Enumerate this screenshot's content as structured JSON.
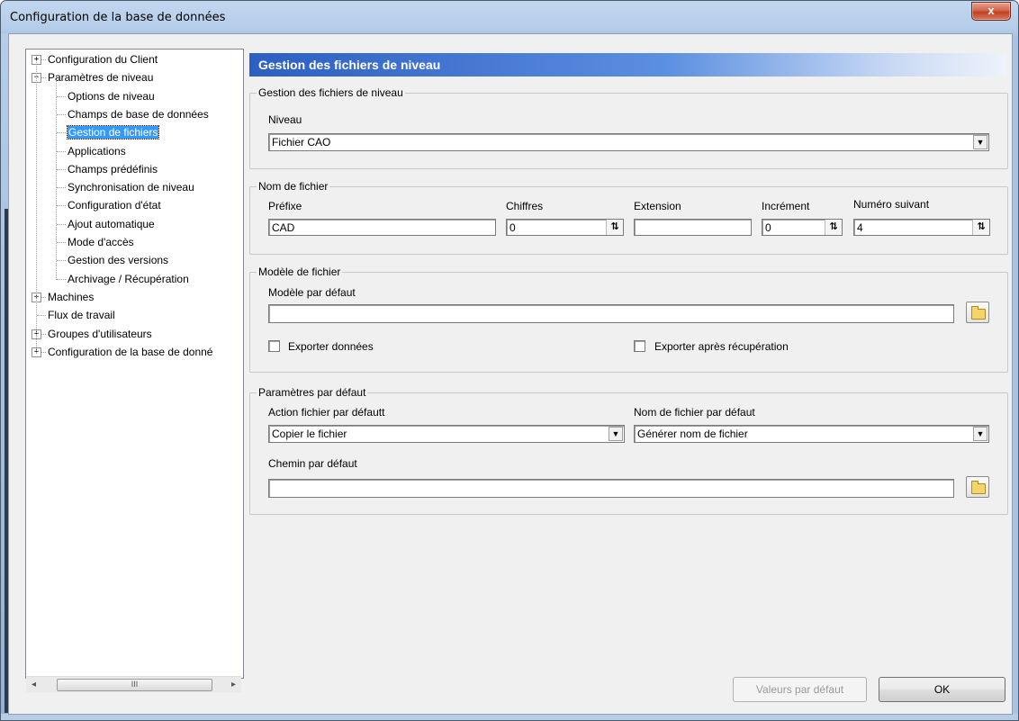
{
  "window": {
    "title": "Configuration de la base de données",
    "close_glyph": "x"
  },
  "tree": {
    "items": [
      {
        "label": "Configuration du Client",
        "expander": "+"
      },
      {
        "label": "Paramètres de niveau",
        "expander": "−"
      },
      {
        "label": "Options de niveau"
      },
      {
        "label": "Champs de base de données"
      },
      {
        "label": "Gestion de fichiers",
        "selected": true
      },
      {
        "label": "Applications"
      },
      {
        "label": "Champs prédéfinis"
      },
      {
        "label": "Synchronisation de niveau"
      },
      {
        "label": "Configuration d'état"
      },
      {
        "label": "Ajout automatique"
      },
      {
        "label": "Mode d'accès"
      },
      {
        "label": "Gestion des versions"
      },
      {
        "label": "Archivage / Récupération"
      },
      {
        "label": "Machines",
        "expander": "+"
      },
      {
        "label": "Flux de travail"
      },
      {
        "label": "Groupes d'utilisateurs",
        "expander": "+"
      },
      {
        "label": "Configuration de la base de donné",
        "expander": "+"
      }
    ],
    "scroll_thumb_glyph": "III"
  },
  "panel": {
    "header": "Gestion des fichiers de niveau",
    "group_level": {
      "title": "Gestion des fichiers de niveau",
      "niveau_label": "Niveau",
      "niveau_value": "Fichier CAO"
    },
    "group_filename": {
      "title": "Nom de fichier",
      "prefix_label": "Préfixe",
      "prefix_value": "CAD",
      "digits_label": "Chiffres",
      "digits_value": "0",
      "extension_label": "Extension",
      "extension_value": "",
      "increment_label": "Incrément",
      "increment_value": "0",
      "next_label": "Numéro suivant",
      "next_value": "4"
    },
    "group_template": {
      "title": "Modèle de fichier",
      "default_template_label": "Modèle par défaut",
      "default_template_value": "",
      "export_data_label": "Exporter données",
      "export_after_label": "Exporter après récupération"
    },
    "group_defaults": {
      "title": "Paramètres par défaut",
      "action_label": "Action fichier par défautt",
      "action_value": "Copier le fichier",
      "name_label": "Nom de fichier par défaut",
      "name_value": "Générer nom de fichier",
      "path_label": "Chemin par défaut",
      "path_value": ""
    }
  },
  "buttons": {
    "defaults": "Valeurs par défaut",
    "ok": "OK"
  },
  "icons": {
    "folder": "folder-icon",
    "dropdown": "chevron-down-icon",
    "spin": "spin-arrows-icon"
  },
  "colors": {
    "selection": "#3399ff",
    "header_start": "#2d5ec2",
    "close": "#c0411f"
  }
}
